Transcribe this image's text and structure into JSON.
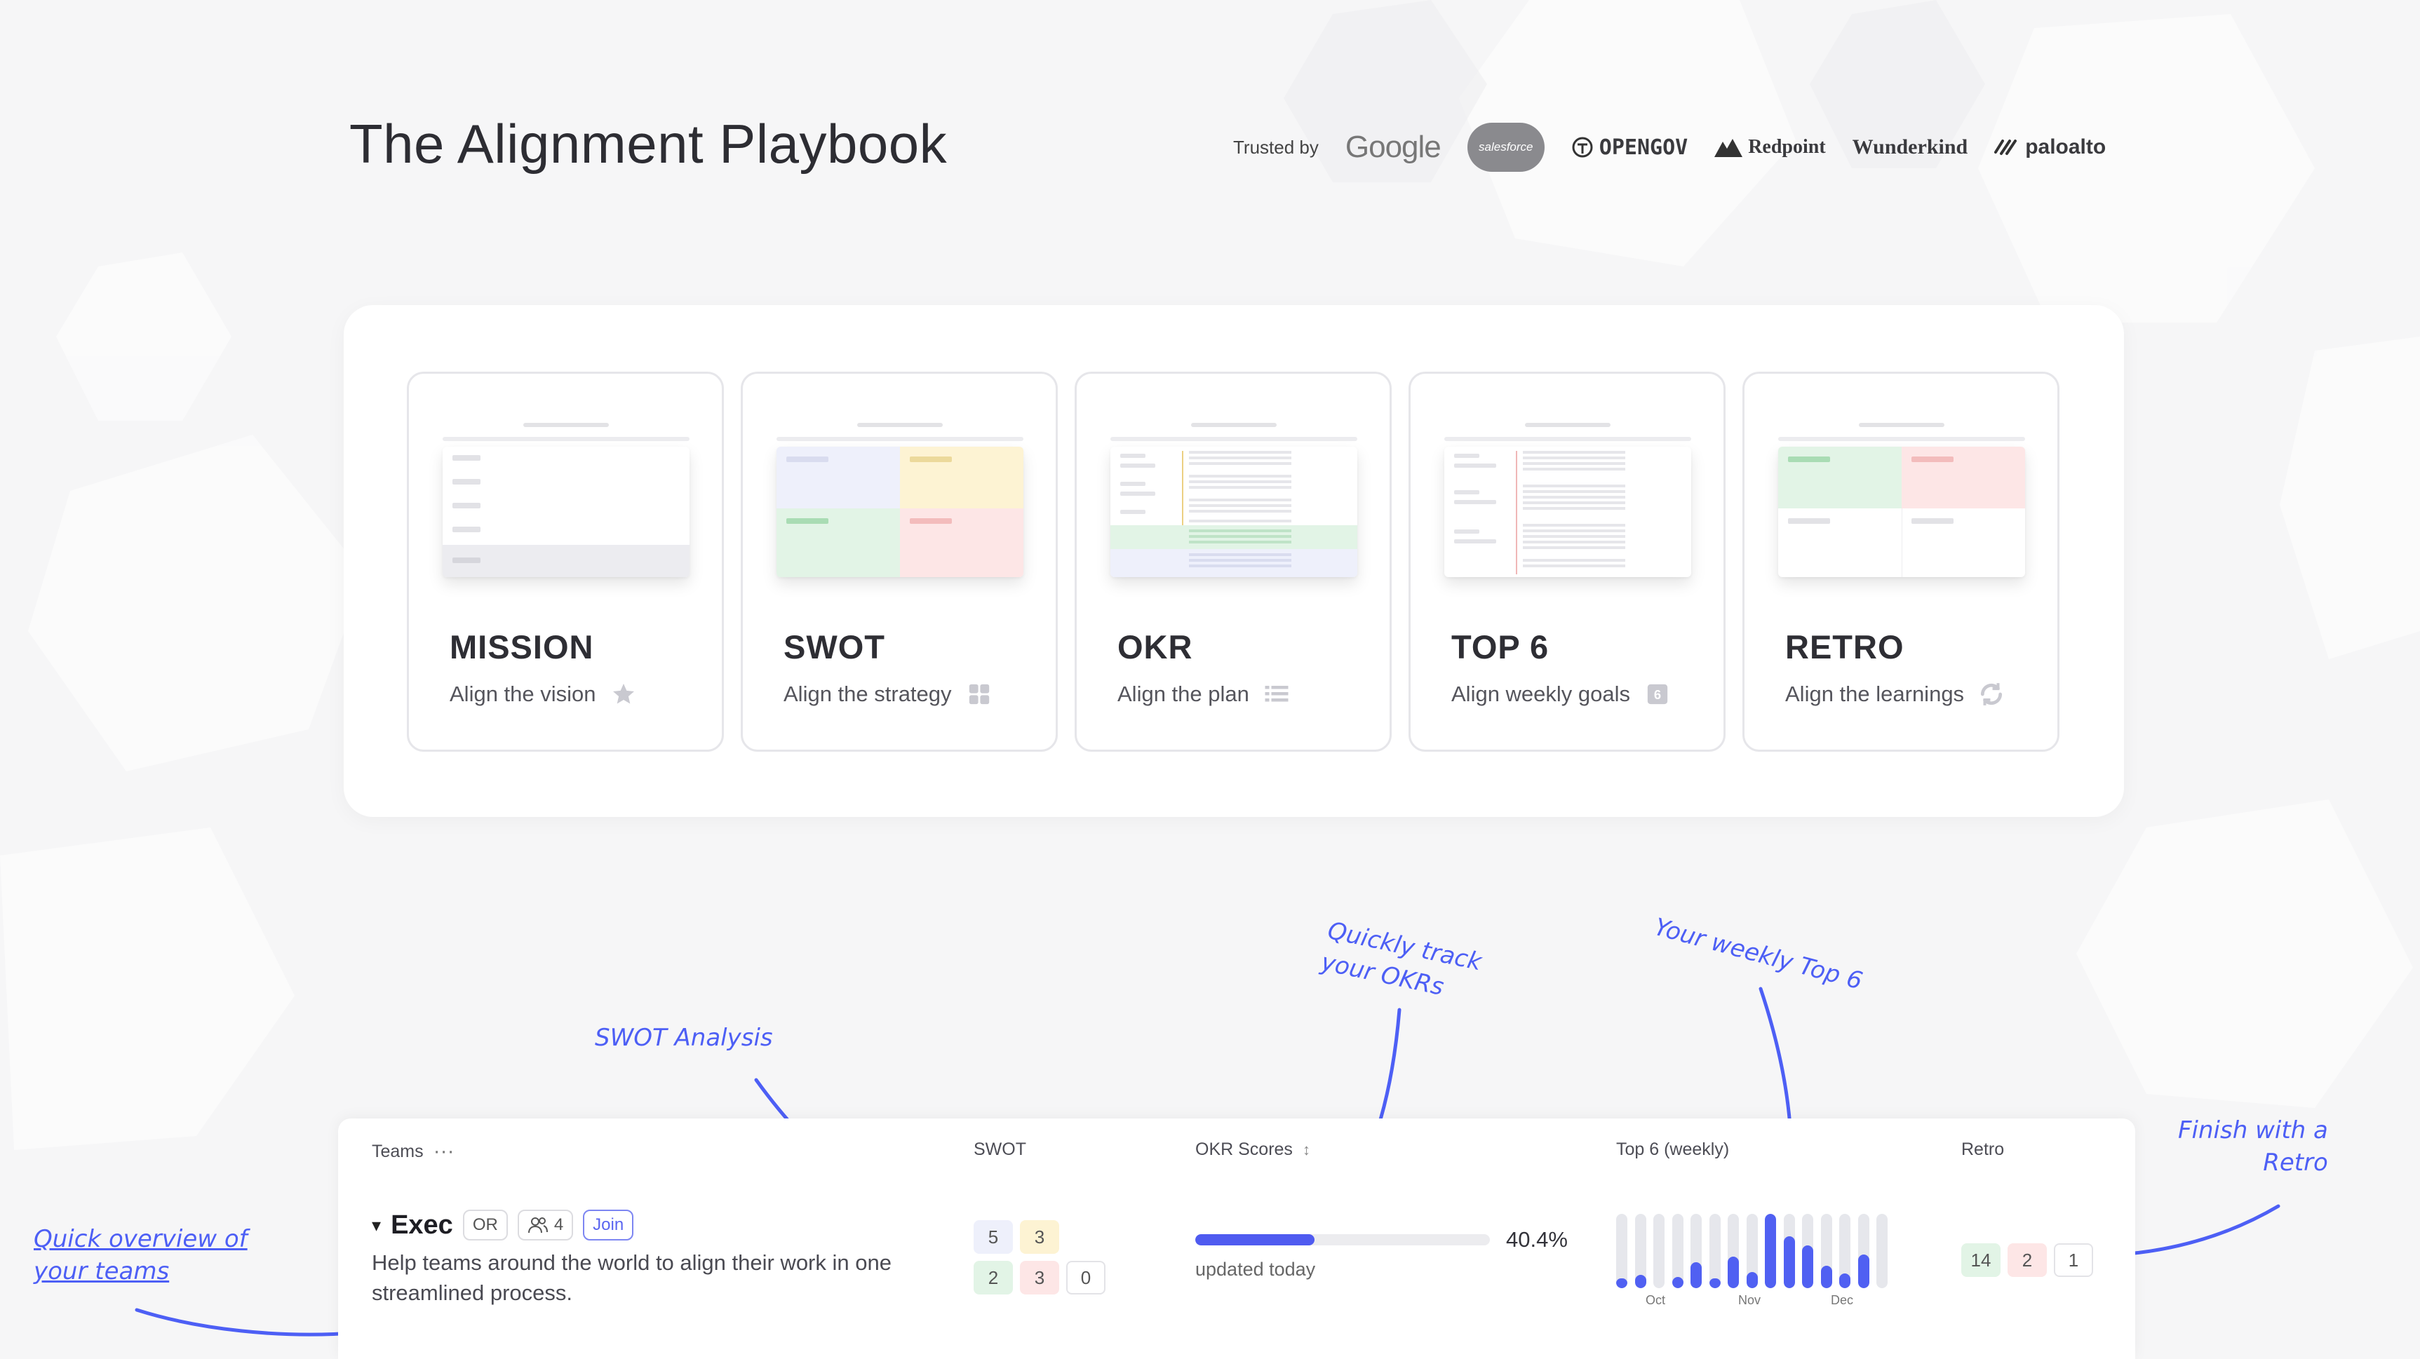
{
  "header": {
    "title": "The Alignment Playbook",
    "trusted_label": "Trusted by",
    "logos": {
      "google": "Google",
      "salesforce": "salesforce",
      "opengov": "OPENGOV",
      "redpoint": "Redpoint",
      "wunderkind": "Wunderkind",
      "paloalto": "paloalto"
    }
  },
  "cards": [
    {
      "title": "MISSION",
      "subtitle": "Align the vision",
      "icon": "star-icon"
    },
    {
      "title": "SWOT",
      "subtitle": "Align the strategy",
      "icon": "grid-icon"
    },
    {
      "title": "OKR",
      "subtitle": "Align the plan",
      "icon": "list-icon"
    },
    {
      "title": "TOP 6",
      "subtitle": "Align weekly goals",
      "icon": "six-badge-icon",
      "icon_text": "6"
    },
    {
      "title": "RETRO",
      "subtitle": "Align the learnings",
      "icon": "refresh-icon"
    }
  ],
  "annotations": {
    "swot": "SWOT Analysis",
    "okr_line1": "Quickly track",
    "okr_line2": "your OKRs",
    "top6": "Your weekly Top 6",
    "retro_line1": "Finish with a",
    "retro_line2": "Retro",
    "teams_line1": "Quick overview of",
    "teams_line2": "your teams"
  },
  "table": {
    "headers": {
      "teams": "Teams",
      "teams_more": "···",
      "swot": "SWOT",
      "okr": "OKR Scores",
      "okr_sort": "↕",
      "top6": "Top 6 (weekly)",
      "retro": "Retro"
    },
    "row": {
      "expand": "▾",
      "name": "Exec",
      "or_badge": "OR",
      "members": "4",
      "join": "Join",
      "description": "Help teams around the world to align their work in one streamlined process.",
      "swot": [
        "5",
        "3",
        "2",
        "3",
        "0"
      ],
      "okr_percent": "40.4%",
      "okr_progress": 0.404,
      "okr_updated": "updated today",
      "weekly_levels": [
        0.12,
        0.18,
        0.0,
        0.15,
        0.35,
        0.12,
        0.42,
        0.22,
        1.0,
        0.7,
        0.58,
        0.3,
        0.2,
        0.45,
        0.0
      ],
      "weekly_labels": [
        "Oct",
        "Nov",
        "Dec"
      ],
      "retro": [
        "14",
        "2",
        "1"
      ]
    }
  },
  "colors": {
    "accent": "#4f5bf0",
    "annotation": "#4d5ff5",
    "swot_s": "#eef0fb",
    "swot_w": "#fdf3d3",
    "swot_o": "#e2f4e6",
    "swot_t": "#fde6e6"
  }
}
